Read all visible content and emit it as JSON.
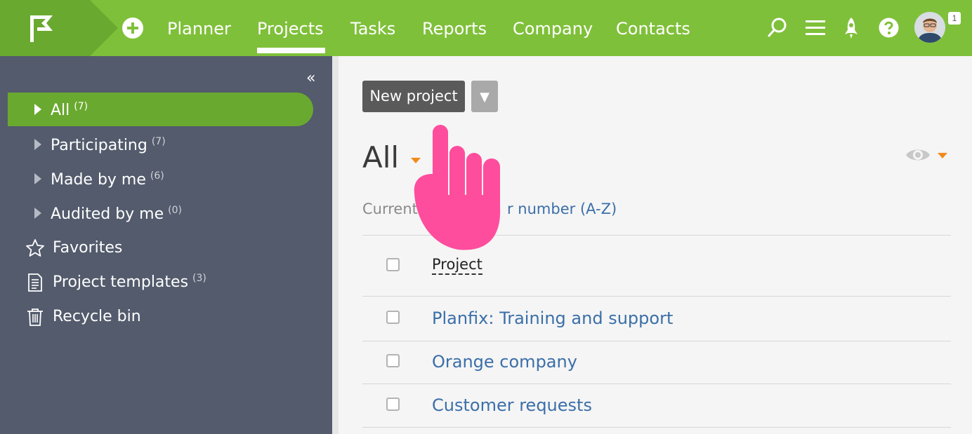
{
  "topbar": {
    "nav": [
      {
        "label": "Planner"
      },
      {
        "label": "Projects"
      },
      {
        "label": "Tasks"
      },
      {
        "label": "Reports"
      },
      {
        "label": "Company"
      },
      {
        "label": "Contacts"
      }
    ],
    "active_nav": "Projects",
    "icons": [
      "search-icon",
      "menu-icon",
      "rocket-icon",
      "help-icon"
    ],
    "notification_count": "1",
    "colors": {
      "bar": "#7fc03a",
      "logo_bg": "#6aa92f"
    }
  },
  "sidebar": {
    "collapse_icon": "«",
    "items": [
      {
        "label": "All",
        "count": "(7)"
      },
      {
        "label": "Participating",
        "count": "(7)"
      },
      {
        "label": "Made by me",
        "count": "(6)"
      },
      {
        "label": "Audited by me",
        "count": "(0)"
      },
      {
        "label": "Favorites",
        "icon": "star-icon"
      },
      {
        "label": "Project templates",
        "count": "(3)",
        "icon": "document-icon"
      },
      {
        "label": "Recycle bin",
        "icon": "trash-icon"
      }
    ],
    "colors": {
      "bg": "#535b6c",
      "active": "#6aa92f"
    }
  },
  "main": {
    "new_project_label": "New project",
    "dropdown_glyph": "▼",
    "view_title": "All",
    "sort_prefix": "Current",
    "sort_value": "r number (A-Z)",
    "column_header": "Project",
    "projects": [
      {
        "name": "Planfix: Training and support"
      },
      {
        "name": "Orange company"
      },
      {
        "name": "Customer requests"
      }
    ],
    "colors": {
      "link": "#3b6fa8",
      "accent_caret": "#f28a1a",
      "pointer_hand": "#ff4d9d"
    }
  }
}
